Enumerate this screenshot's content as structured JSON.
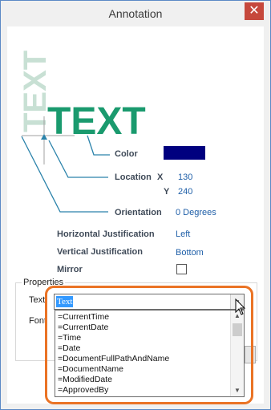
{
  "window": {
    "title": "Annotation",
    "close_glyph": "✕"
  },
  "preview": {
    "text_rotated": "TEXT",
    "text_normal": "TEXT",
    "text_rotated_color": "#c8e0d4",
    "text_color": "#1a9a6e",
    "leader_color": "#2a82aa"
  },
  "fields": {
    "color": {
      "label": "Color",
      "value_hex": "#00007f"
    },
    "location": {
      "label": "Location",
      "x_label": "X",
      "x_value": "130",
      "y_label": "Y",
      "y_value": "240"
    },
    "orientation": {
      "label": "Orientation",
      "value": "0 Degrees"
    },
    "horizontal_justification": {
      "label": "Horizontal Justification",
      "value": "Left"
    },
    "vertical_justification": {
      "label": "Vertical Justification",
      "value": "Bottom"
    },
    "mirror": {
      "label": "Mirror",
      "checked": false
    }
  },
  "properties": {
    "group_title": "Properties",
    "text_label": "Text",
    "text_value": "Text",
    "font_label": "Font",
    "dropdown_arrow": "▾",
    "options": [
      "=CurrentTime",
      "=CurrentDate",
      "=Time",
      "=Date",
      "=DocumentFullPathAndName",
      "=DocumentName",
      "=ModifiedDate",
      "=ApprovedBy"
    ],
    "scroll_up_glyph": "▲",
    "scroll_down_glyph": "▼"
  },
  "colors": {
    "label": "#3f4a58",
    "value": "#1f5fa8",
    "highlight": "#ea7325",
    "selection": "#3399ff"
  }
}
